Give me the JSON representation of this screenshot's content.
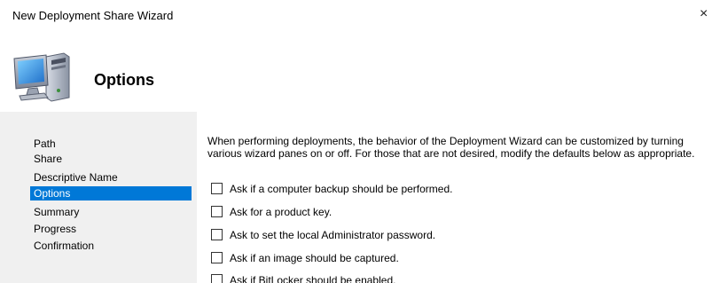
{
  "window": {
    "title": "New Deployment Share Wizard",
    "close_glyph": "×"
  },
  "header": {
    "title": "Options",
    "icon": "computer-icon"
  },
  "steps": {
    "items": [
      {
        "label": "Path",
        "selected": false
      },
      {
        "label": "Share",
        "selected": false
      },
      {
        "label": "Descriptive Name",
        "selected": false
      },
      {
        "label": "Options",
        "selected": true
      },
      {
        "label": "Summary",
        "selected": false
      },
      {
        "label": "Progress",
        "selected": false
      },
      {
        "label": "Confirmation",
        "selected": false
      }
    ],
    "selected_color": "#0078d7"
  },
  "content": {
    "description": "When performing deployments, the behavior of the Deployment Wizard can be customized by turning various wizard panes on or off.  For those that are not desired, modify the defaults below as appropriate.",
    "options": [
      {
        "label": "Ask if a computer backup should be performed.",
        "checked": false
      },
      {
        "label": "Ask for a product key.",
        "checked": false
      },
      {
        "label": "Ask to set the local Administrator password.",
        "checked": false
      },
      {
        "label": "Ask if an image should be captured.",
        "checked": false
      },
      {
        "label": "Ask if BitLocker should be enabled.",
        "checked": false
      }
    ]
  }
}
